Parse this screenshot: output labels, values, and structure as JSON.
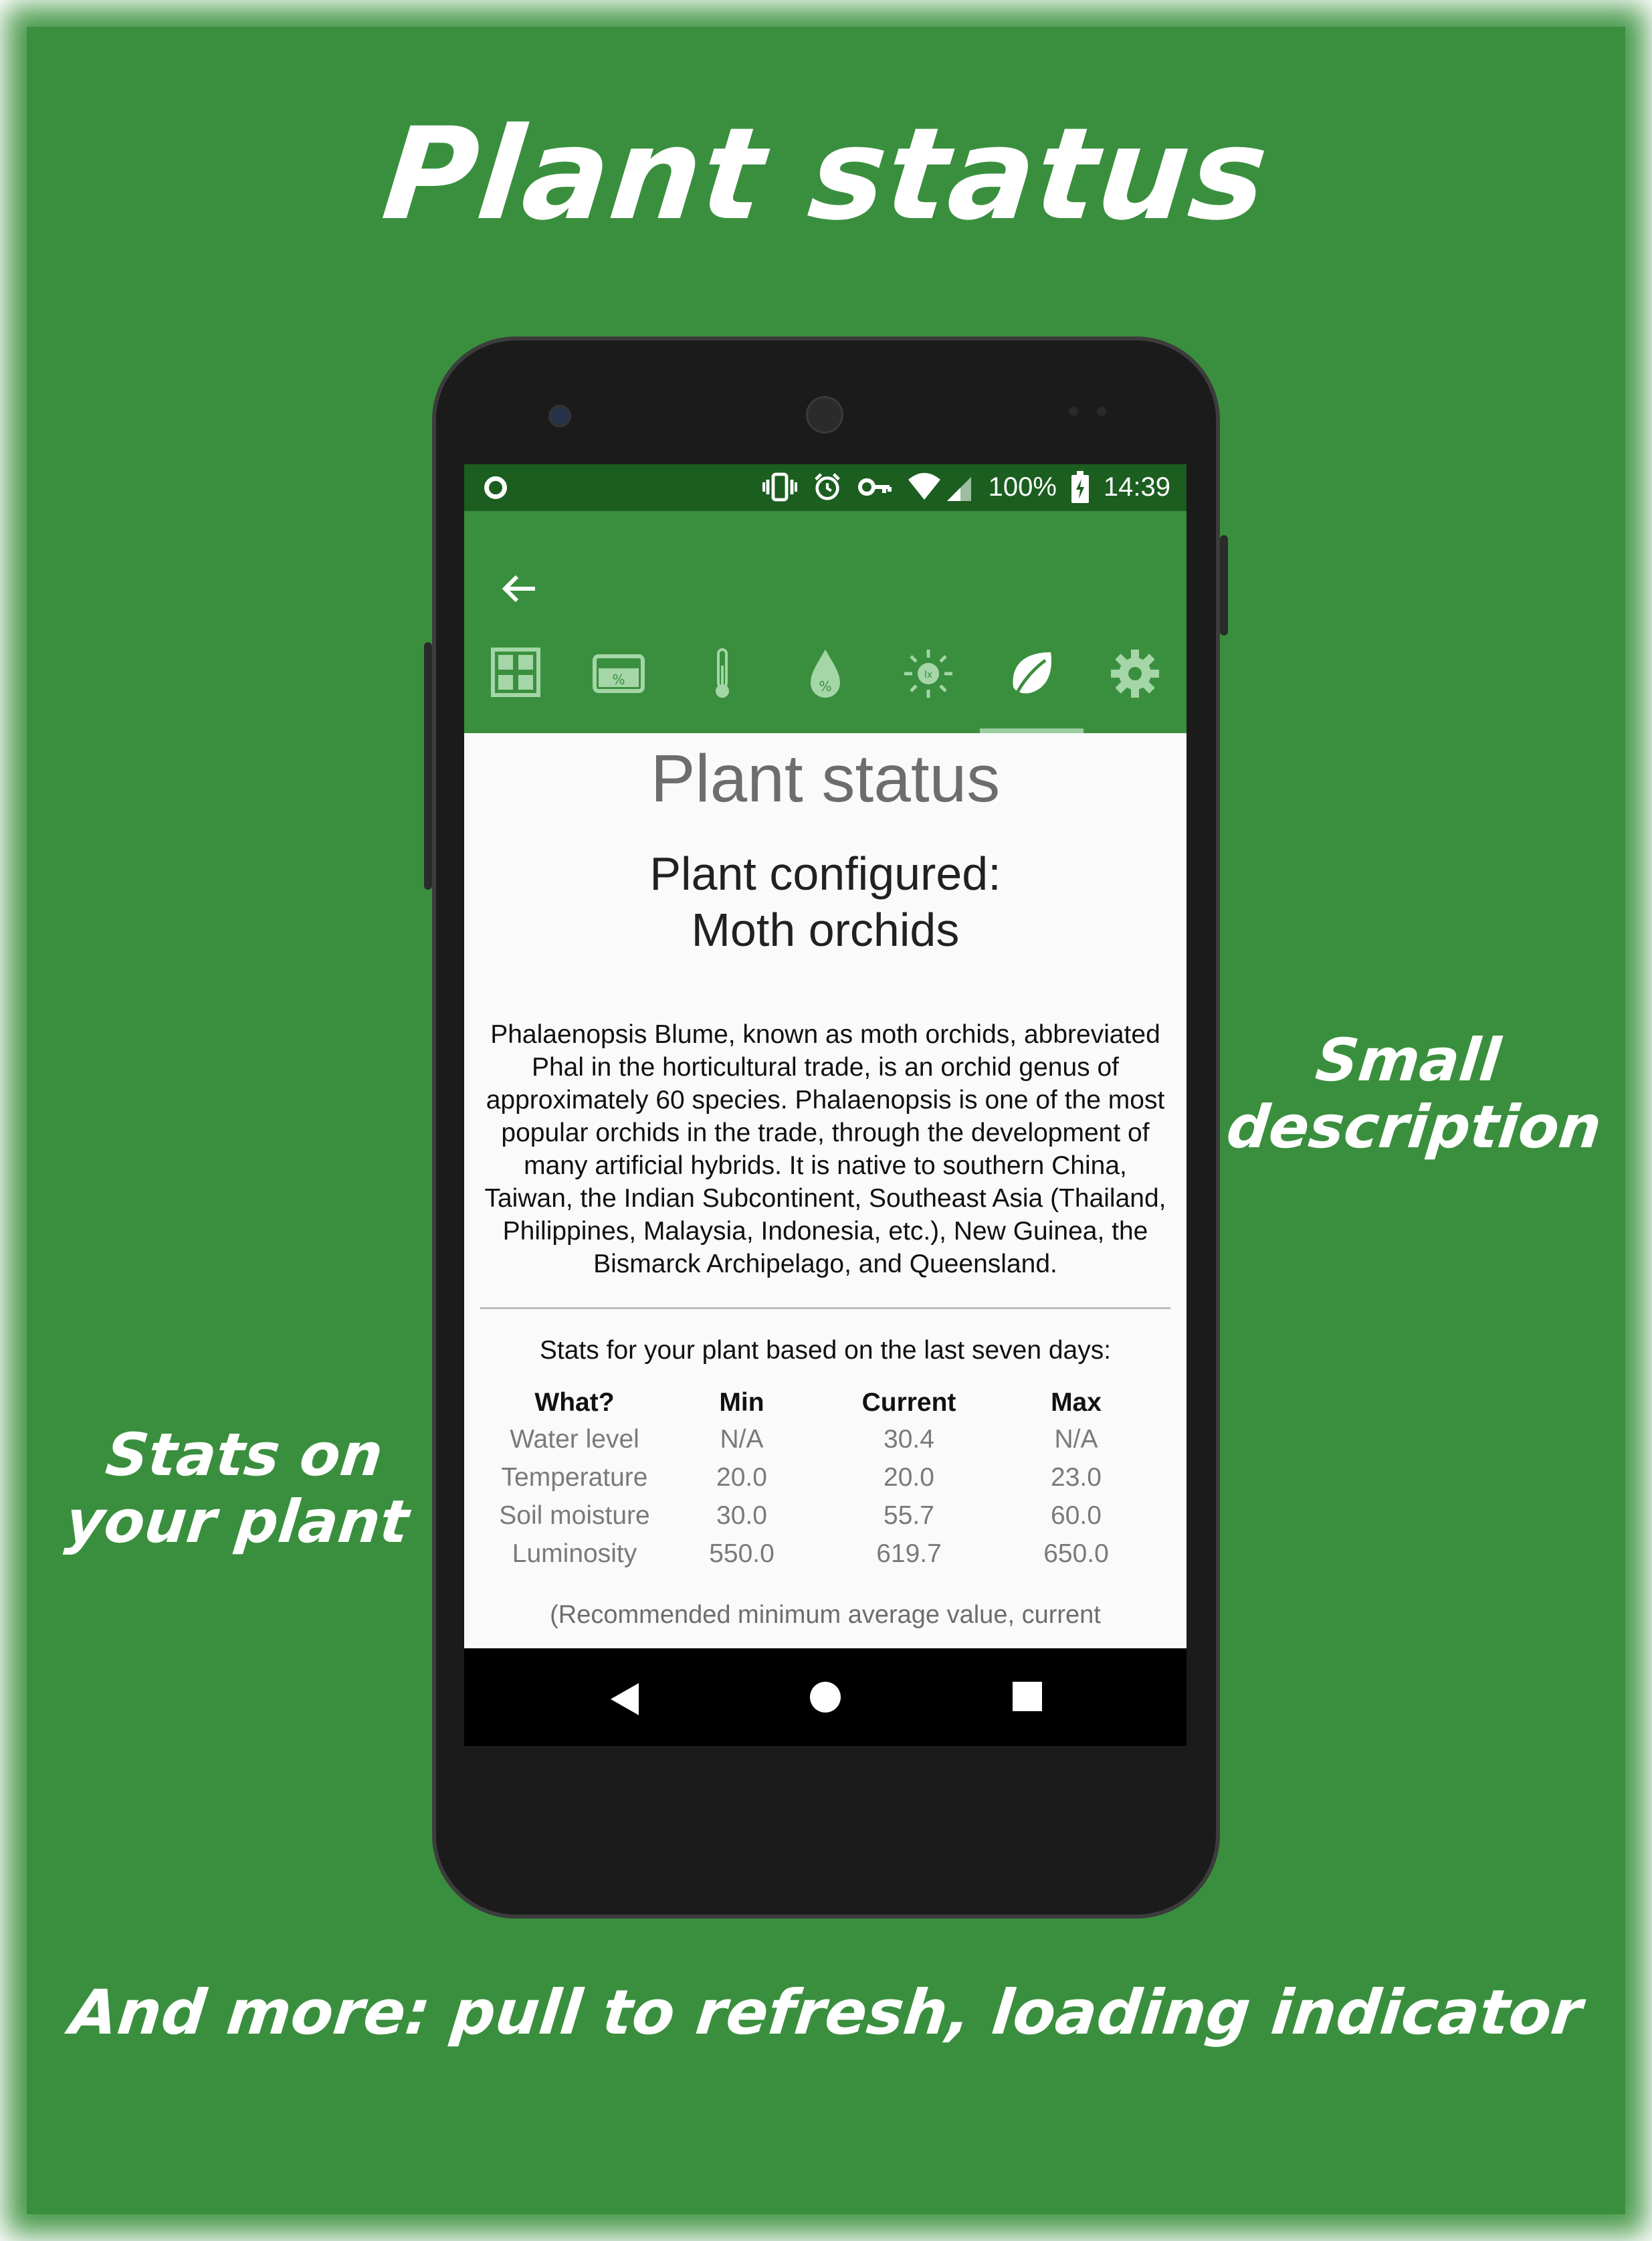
{
  "poster": {
    "title": "Plant status",
    "annotation_description": "Small description",
    "annotation_stats": "Stats on your plant",
    "bottom_caption": "And more: pull to refresh, loading indicator"
  },
  "statusbar": {
    "battery": "100%",
    "time": "14:39"
  },
  "tabs": [
    {
      "icon": "dashboard-grid-icon"
    },
    {
      "icon": "water-level-icon",
      "glyph": "%"
    },
    {
      "icon": "thermometer-icon"
    },
    {
      "icon": "soil-moisture-drop-icon",
      "glyph": "%"
    },
    {
      "icon": "luminosity-sun-icon",
      "glyph": "lx"
    },
    {
      "icon": "leaf-icon",
      "active": true
    },
    {
      "icon": "gear-icon"
    }
  ],
  "content": {
    "heading": "Plant status",
    "configured_label": "Plant configured:",
    "plant_name": "Moth orchids",
    "description": "Phalaenopsis Blume, known as moth orchids, abbreviated Phal in the horticultural trade, is an orchid genus of approximately 60 species. Phalaenopsis is one of the most popular orchids in the trade, through the development of many artificial hybrids. It is native to southern China, Taiwan, the Indian Subcontinent, Southeast Asia (Thailand, Philippines, Malaysia, Indonesia, etc.), New Guinea, the Bismarck Archipelago, and Queensland.",
    "stats_heading": "Stats for your plant based on the last seven days:",
    "stats": {
      "headers": [
        "What?",
        "Min",
        "Current",
        "Max"
      ],
      "rows": [
        [
          "Water level",
          "N/A",
          "30.4",
          "N/A"
        ],
        [
          "Temperature",
          "20.0",
          "20.0",
          "23.0"
        ],
        [
          "Soil moisture",
          "30.0",
          "55.7",
          "60.0"
        ],
        [
          "Luminosity",
          "550.0",
          "619.7",
          "650.0"
        ]
      ]
    },
    "footnote": "(Recommended minimum average value, current"
  },
  "colors": {
    "poster_bg": "#3a8f3e",
    "statusbar_bg": "#1b5e20",
    "appbar_bg": "#3a8f3e",
    "tab_icon": "#a5d6a7",
    "tab_indicator": "#9ccc9f"
  }
}
